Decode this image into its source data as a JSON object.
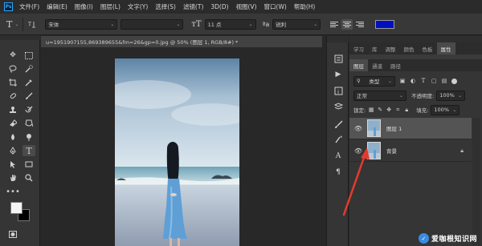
{
  "app": {
    "logo": "Ps"
  },
  "menu": [
    "文件(F)",
    "编辑(E)",
    "图像(I)",
    "图层(L)",
    "文字(Y)",
    "选择(S)",
    "滤镜(T)",
    "3D(D)",
    "视图(V)",
    "窗口(W)",
    "帮助(H)"
  ],
  "options": {
    "font_family": "宋体",
    "font_size": "11 点",
    "antialias": "锐利",
    "text_color": "#0010c0"
  },
  "document": {
    "tab_title": "u=1951907155,869389655&fm=26&gp=0.jpg @ 50% (图层 1, RGB/8#) *"
  },
  "panels": {
    "top_tabs": [
      "学习",
      "库",
      "调整",
      "颜色",
      "色板",
      "属性"
    ],
    "active_top_tab": "属性",
    "layer_tabs": [
      "图层",
      "通道",
      "路径"
    ],
    "filter_label": "类型",
    "blend_mode": "正常",
    "opacity_label": "不透明度:",
    "opacity_value": "100%",
    "lock_label": "锁定:",
    "fill_label": "填充:",
    "fill_value": "100%",
    "layers": [
      {
        "name": "图层 1",
        "selected": true,
        "locked": false
      },
      {
        "name": "背景",
        "selected": false,
        "locked": true
      }
    ]
  },
  "annotation": {
    "color": "#e23b2e"
  },
  "watermark": {
    "text": "爱咖根知识网"
  },
  "icons": [
    "move-icon",
    "marquee-icon",
    "lasso-icon",
    "quick-select-icon",
    "crop-icon",
    "eyedropper-icon",
    "healing-icon",
    "brush-icon",
    "stamp-icon",
    "history-brush-icon",
    "eraser-icon",
    "gradient-icon",
    "blur-icon",
    "dodge-icon",
    "pen-icon",
    "type-icon",
    "path-select-icon",
    "rectangle-icon",
    "hand-icon",
    "zoom-icon",
    "more-icon",
    "eye-icon",
    "lock-icon"
  ]
}
